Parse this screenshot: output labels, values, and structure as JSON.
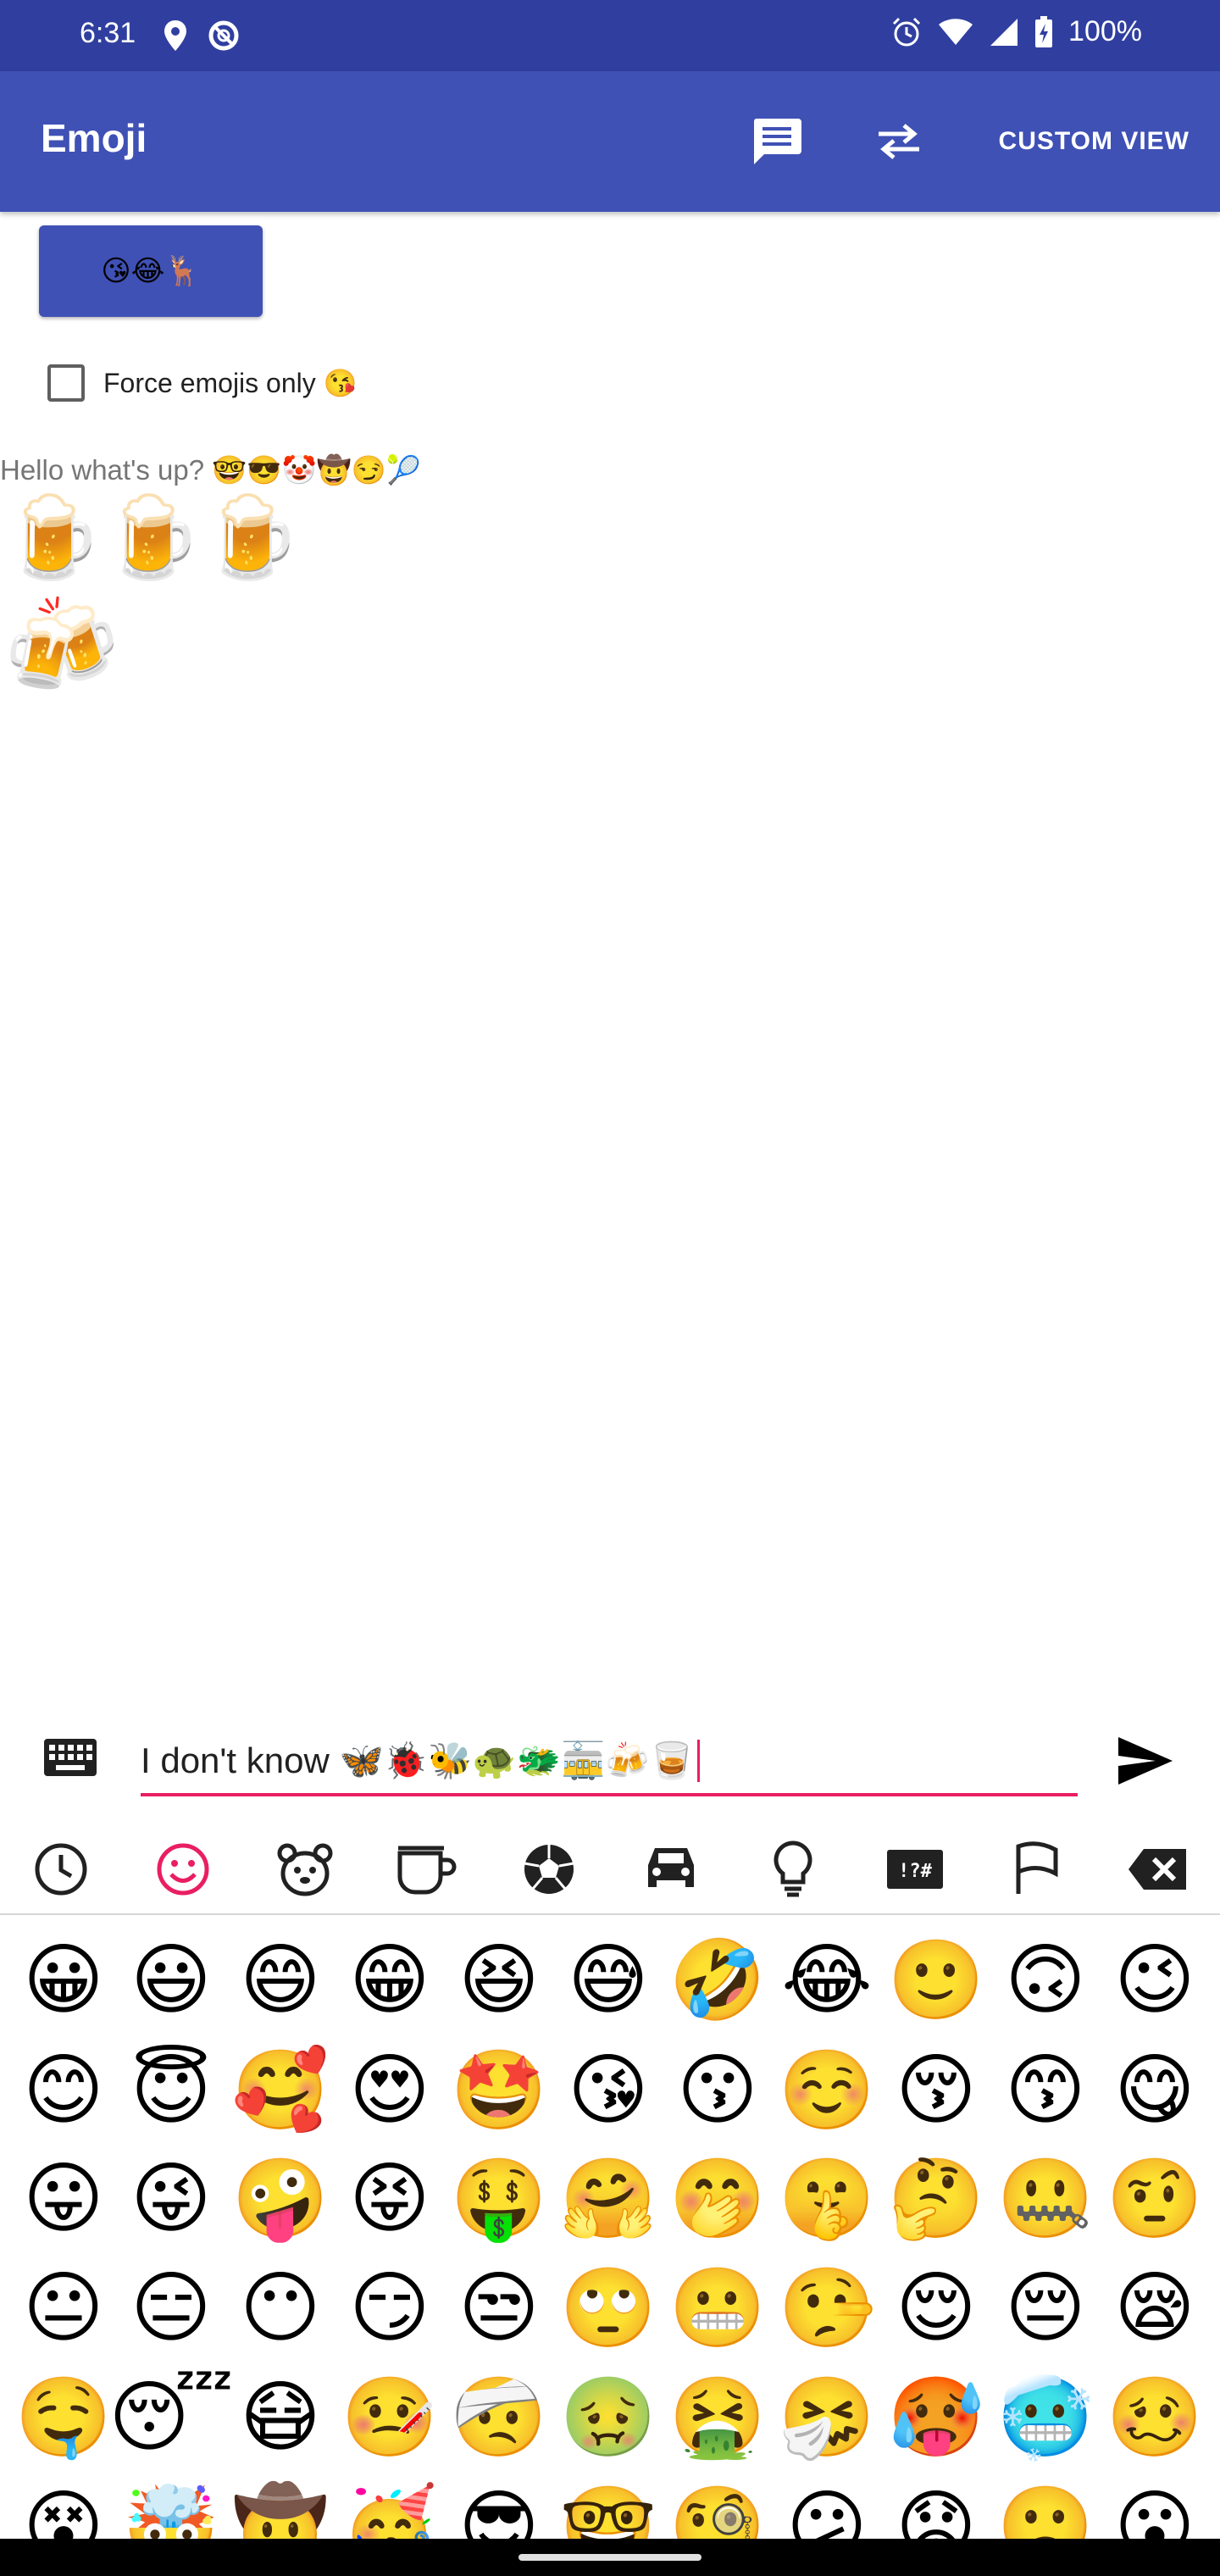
{
  "status_bar": {
    "time": "6:31",
    "battery": "100%"
  },
  "app_bar": {
    "title": "Emoji",
    "custom_view_label": "CUSTOM VIEW"
  },
  "emoji_button": {
    "label": "😘😂🦌"
  },
  "force_checkbox": {
    "label": "Force emojis only 😘",
    "checked": false
  },
  "messages": {
    "hello": "Hello what's up? 🤓😎🤡🤠😏🎾",
    "beers": "🍺🍺🍺",
    "clinking": "🍻"
  },
  "input": {
    "value": "I don't know 🦋🐞🐝🐢🐲🚋🍻🥃"
  },
  "categories": [
    "recent-icon",
    "smileys-icon",
    "animals-icon",
    "food-icon",
    "activity-icon",
    "travel-icon",
    "objects-icon",
    "symbols-icon",
    "flags-icon",
    "backspace-icon"
  ],
  "emoji_grid": [
    [
      "😀",
      "😃",
      "😄",
      "😁",
      "😆",
      "😅",
      "🤣",
      "😂",
      "🙂",
      "🙃",
      "😉"
    ],
    [
      "😊",
      "😇",
      "🥰",
      "😍",
      "🤩",
      "😘",
      "😗",
      "☺️",
      "😚",
      "😙",
      "😋"
    ],
    [
      "😛",
      "😜",
      "🤪",
      "😝",
      "🤑",
      "🤗",
      "🤭",
      "🤫",
      "🤔",
      "🤐",
      "🤨"
    ],
    [
      "😐",
      "😑",
      "😶",
      "😏",
      "😒",
      "🙄",
      "😬",
      "🤥",
      "😌",
      "😔",
      "😪"
    ],
    [
      "🤤",
      "😴",
      "😷",
      "🤒",
      "🤕",
      "🤢",
      "🤮",
      "🤧",
      "🥵",
      "🥶",
      "🥴"
    ],
    [
      "😵",
      "🤯",
      "🤠",
      "🥳",
      "😎",
      "🤓",
      "🧐",
      "😕",
      "😟",
      "🙁",
      "😮"
    ]
  ],
  "colors": {
    "primary": "#3f51b5",
    "primary_dark": "#303f9f",
    "accent": "#e91e63"
  }
}
